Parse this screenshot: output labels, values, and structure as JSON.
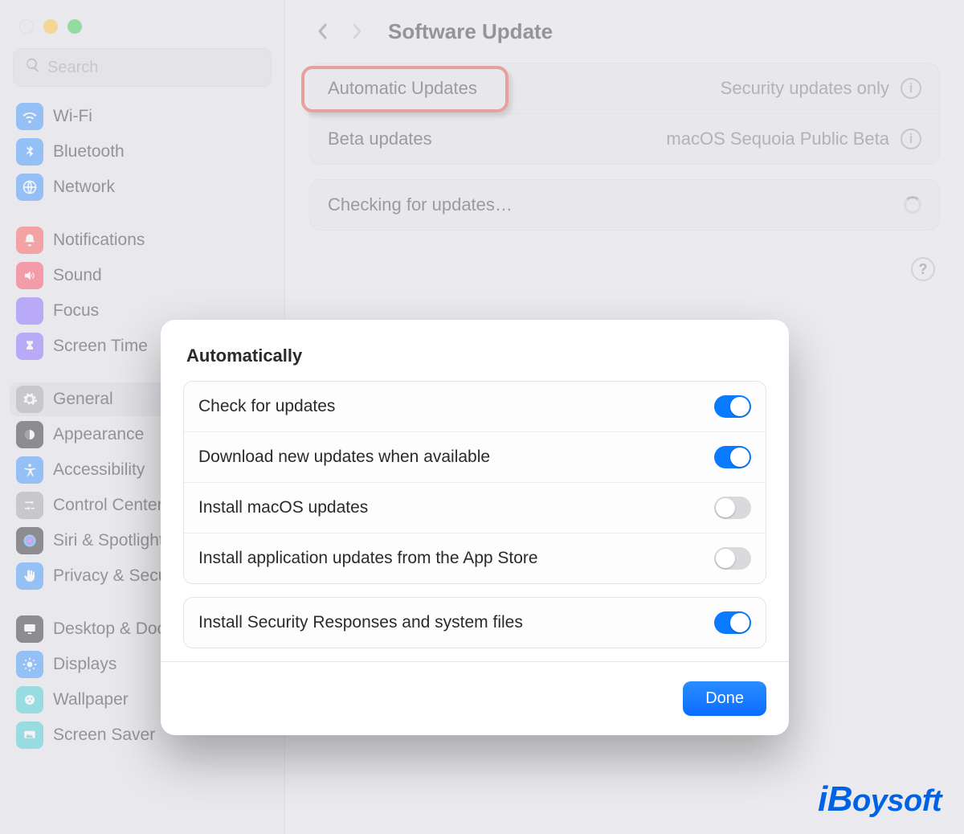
{
  "header": {
    "title": "Software Update"
  },
  "search": {
    "placeholder": "Search"
  },
  "sidebar": {
    "items": [
      {
        "label": "Wi-Fi",
        "icon": "wifi",
        "bg": "#2e8cff"
      },
      {
        "label": "Bluetooth",
        "icon": "bluetooth",
        "bg": "#2e8cff"
      },
      {
        "label": "Network",
        "icon": "network",
        "bg": "#2e8cff"
      },
      {
        "label": "Notifications",
        "icon": "bell",
        "bg": "#ff4d4d"
      },
      {
        "label": "Sound",
        "icon": "sound",
        "bg": "#ff3b54"
      },
      {
        "label": "Focus",
        "icon": "focus",
        "bg": "#7a5cff"
      },
      {
        "label": "Screen Time",
        "icon": "hourglass",
        "bg": "#7a5cff"
      },
      {
        "label": "General",
        "icon": "gear",
        "bg": "#9d9da3",
        "selected": true
      },
      {
        "label": "Appearance",
        "icon": "appearance",
        "bg": "#1c1c1f"
      },
      {
        "label": "Accessibility",
        "icon": "accessibility",
        "bg": "#2e8cff"
      },
      {
        "label": "Control Center",
        "icon": "sliders",
        "bg": "#9d9da3"
      },
      {
        "label": "Siri & Spotlight",
        "icon": "siri",
        "bg": "#1c1c1f"
      },
      {
        "label": "Privacy & Security",
        "icon": "hand",
        "bg": "#2e8cff"
      },
      {
        "label": "Desktop & Dock",
        "icon": "desktop",
        "bg": "#1c1c1f"
      },
      {
        "label": "Displays",
        "icon": "displays",
        "bg": "#2e8cff"
      },
      {
        "label": "Wallpaper",
        "icon": "wallpaper",
        "bg": "#33c7d1"
      },
      {
        "label": "Screen Saver",
        "icon": "screensaver",
        "bg": "#33c7d1"
      }
    ]
  },
  "panel": {
    "rows": [
      {
        "label": "Automatic Updates",
        "value": "Security updates only",
        "highlighted": true
      },
      {
        "label": "Beta updates",
        "value": "macOS Sequoia Public Beta"
      }
    ],
    "status_label": "Checking for updates…"
  },
  "sheet": {
    "heading": "Automatically",
    "group1": [
      {
        "label": "Check for updates",
        "on": true
      },
      {
        "label": "Download new updates when available",
        "on": true
      },
      {
        "label": "Install macOS updates",
        "on": false
      },
      {
        "label": "Install application updates from the App Store",
        "on": false
      }
    ],
    "group2": [
      {
        "label": "Install Security Responses and system files",
        "on": true
      }
    ],
    "done_label": "Done"
  },
  "watermark": "iBoysoft"
}
